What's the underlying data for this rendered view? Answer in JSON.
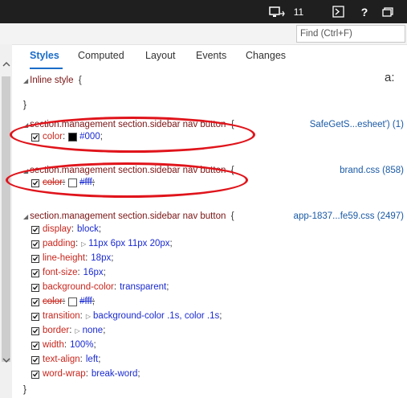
{
  "topbar": {
    "count": "11"
  },
  "find": {
    "placeholder": "Find (Ctrl+F)"
  },
  "tabs": [
    {
      "label": "Styles",
      "active": true
    },
    {
      "label": "Computed"
    },
    {
      "label": "Layout"
    },
    {
      "label": "Events"
    },
    {
      "label": "Changes"
    }
  ],
  "inline_style": {
    "label": "Inline style",
    "open": "{",
    "close": "}"
  },
  "rules": [
    {
      "selector": "section.management section.sidebar nav button",
      "source": "SafeGetS...esheet') (1)",
      "props": [
        {
          "name": "color",
          "value": "#000",
          "swatch": "#000000"
        }
      ]
    },
    {
      "selector": "section.management section.sidebar nav button",
      "source": "brand.css (858)",
      "props": [
        {
          "name": "color",
          "value": "#fff",
          "swatch": "#ffffff",
          "struck": true
        }
      ]
    },
    {
      "selector": "section.management section.sidebar nav button",
      "source": "app-1837...fe59.css (2497)",
      "props": [
        {
          "name": "display",
          "value": "block"
        },
        {
          "name": "padding",
          "value": "11px 6px 11px 20px",
          "expandable": true
        },
        {
          "name": "line-height",
          "value": "18px"
        },
        {
          "name": "font-size",
          "value": "16px"
        },
        {
          "name": "background-color",
          "value": "transparent"
        },
        {
          "name": "color",
          "value": "#fff",
          "swatch": "#ffffff",
          "struck": true
        },
        {
          "name": "transition",
          "value": "background-color .1s, color .1s",
          "expandable": true
        },
        {
          "name": "border",
          "value": "none",
          "expandable": true
        },
        {
          "name": "width",
          "value": "100%"
        },
        {
          "name": "text-align",
          "value": "left"
        },
        {
          "name": "word-wrap",
          "value": "break-word"
        }
      ]
    }
  ],
  "symbols": {
    "open_brace": "{",
    "close_brace": "}",
    "colon": ":",
    "semicolon": ";",
    "font_glyph": "a:"
  },
  "annotation": {
    "color": "#e0141b"
  }
}
